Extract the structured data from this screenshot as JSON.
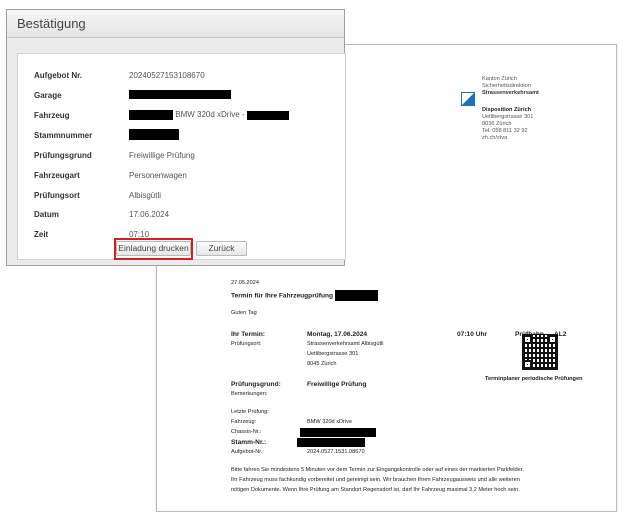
{
  "dialog": {
    "title": "Bestätigung",
    "rows": [
      {
        "label": "Aufgebot Nr.",
        "value": "20240527153108670"
      },
      {
        "label": "Garage",
        "value": ""
      },
      {
        "label": "Fahrzeug",
        "value": "BMW 320d xDrive -"
      },
      {
        "label": "Stammnummer",
        "value": ""
      },
      {
        "label": "Prüfungsgrund",
        "value": "Freiwillige Prüfung"
      },
      {
        "label": "Fahrzeugart",
        "value": "Personenwagen"
      },
      {
        "label": "Prüfungsort",
        "value": "Albisgütli"
      },
      {
        "label": "Datum",
        "value": "17.06.2024"
      },
      {
        "label": "Zeit",
        "value": "07:10"
      }
    ],
    "buttons": {
      "print": "Einladung drucken",
      "back": "Zurück"
    },
    "highlight_color": "#d42020"
  },
  "letter": {
    "sender": [
      "Kanton Zürich",
      "Sicherheitsdirektion",
      "Strassenverkehrsamt"
    ],
    "disposition": {
      "title": "Disposition Zürich",
      "lines": [
        "Uetlibergstrasse 301",
        "8036 Zürich",
        "Tel. 058 811 32 92",
        "zh.ch/stva"
      ]
    },
    "date": "27.05.2024",
    "subject": "Termin für Ihre Fahrzeugprüfung",
    "greeting": "Guten Tag",
    "appointment_label": "Ihr Termin:",
    "appointment_date": "Montag, 17.06.2024",
    "appointment_time": "07:10 Uhr",
    "lane_label": "Prüfbahn",
    "lane_value": "AL2",
    "location_label": "Prüfungsort:",
    "location_lines": [
      "Strassenverkehrsamt Albisgütli",
      "Uetlibergstrasse 301",
      "8045 Zürich"
    ],
    "qr_caption": "Terminplaner periodische Prüfungen",
    "reason_label": "Prüfungsgrund:",
    "reason_value": "Freiwillige Prüfung",
    "remarks_label": "Bemerkungen:",
    "last_check_label": "Letzte Prüfung:",
    "vehicle_label": "Fahrzeug:",
    "vehicle_value": "BMW 320d xDrive",
    "chassis_label": "Chassis-Nr.:",
    "stamm_label": "Stamm-Nr.:",
    "order_label": "Aufgebot-Nr.:",
    "order_value": "2024.0527.1531.08670",
    "body": [
      "Bitte fahren Sie mindestens 5 Minuten vor dem Termin zur Eingangskontrolle oder auf eines der markierten Parkfelder.",
      "Ihr Fahrzeug muss fachkundig vorbereitet und gereinigt sein. Wir brauchen Ihren Fahrzeugausweis und alle weiteren",
      "nötigen Dokumente. Wenn Ihre Prüfung am Standort Regensdorf ist, darf Ihr Fahrzeug maximal 3,2 Meter hoch sein."
    ]
  }
}
